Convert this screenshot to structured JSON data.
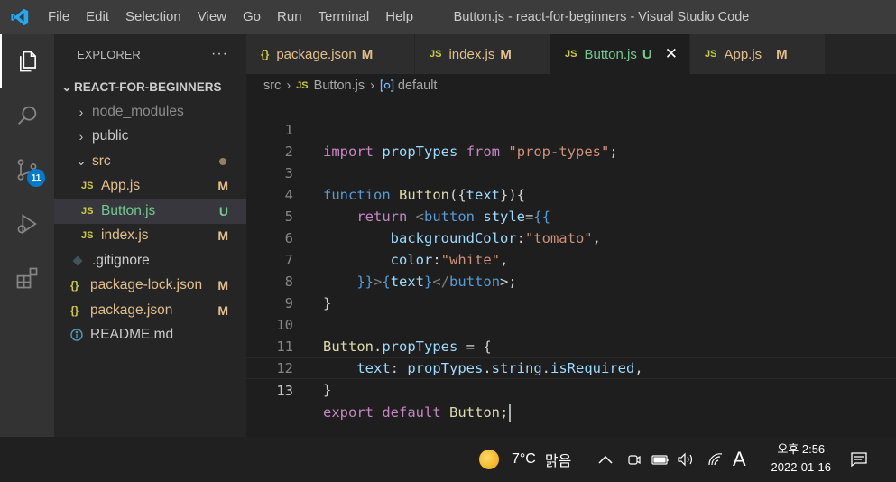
{
  "titlebar": {
    "menu": [
      "File",
      "Edit",
      "Selection",
      "View",
      "Go",
      "Run",
      "Terminal",
      "Help"
    ],
    "window_title": "Button.js - react-for-beginners - Visual Studio Code"
  },
  "activitybar": {
    "items": [
      "explorer-icon",
      "search-icon",
      "source-control-icon",
      "run-debug-icon",
      "extensions-icon"
    ],
    "scm_badge": "11"
  },
  "sidebar": {
    "title": "EXPLORER",
    "more": "···",
    "project": "REACT-FOR-BEGINNERS",
    "rows": [
      {
        "label": "node_modules",
        "status": ""
      },
      {
        "label": "public",
        "status": ""
      },
      {
        "label": "src",
        "status": ""
      },
      {
        "label": "App.js",
        "status": "M"
      },
      {
        "label": "Button.js",
        "status": "U"
      },
      {
        "label": "index.js",
        "status": "M"
      },
      {
        "label": ".gitignore",
        "status": ""
      },
      {
        "label": "package-lock.json",
        "status": "M"
      },
      {
        "label": "package.json",
        "status": "M"
      },
      {
        "label": "README.md",
        "status": ""
      }
    ]
  },
  "tabs": [
    {
      "icon": "{}",
      "label": "package.json",
      "status": "M"
    },
    {
      "icon": "JS",
      "label": "index.js",
      "status": "M"
    },
    {
      "icon": "JS",
      "label": "Button.js",
      "status": "U",
      "close": "✕"
    },
    {
      "icon": "JS",
      "label": "App.js",
      "status": "M"
    }
  ],
  "breadcrumb": {
    "folder": "src",
    "file": "Button.js",
    "symbol": "default",
    "js_icon": "JS"
  },
  "editor": {
    "line_numbers": [
      "1",
      "2",
      "3",
      "4",
      "5",
      "6",
      "7",
      "8",
      "9",
      "10",
      "11",
      "12",
      "13"
    ],
    "tokens": {
      "l1_import": "import",
      "l1_name": "propTypes",
      "l1_from": "from",
      "l1_module": "\"prop-types\"",
      "l1_semi": ";",
      "l3_function": "function",
      "l3_name": "Button",
      "l3_open": "({",
      "l3_param": "text",
      "l3_close": "}){",
      "l4_return": "return",
      "l4_lt": "<",
      "l4_tag": "button",
      "l4_attr": "style",
      "l4_eq": "=",
      "l4_braces": "{{",
      "l5_prop": "backgroundColor",
      "l5_colon": ":",
      "l5_val": "\"tomato\"",
      "l5_comma": ",",
      "l6_prop": "color",
      "l6_colon": ":",
      "l6_val": "\"white\"",
      "l6_comma": ",",
      "l7_braces": "}}",
      "l7_gt": ">",
      "l7_lb": "{",
      "l7_text": "text",
      "l7_rb": "}",
      "l7_close_lt": "</",
      "l7_tag": "button",
      "l7_end": ">;",
      "l8": "}",
      "l10_name": "Button",
      "l10_dot": ".",
      "l10_prop": "propTypes",
      "l10_rest": " = {",
      "l11_key": "text",
      "l11_colon": ": ",
      "l11_obj": "propTypes",
      "l11_dot1": ".",
      "l11_type": "string",
      "l11_dot2": ".",
      "l11_req": "isRequired",
      "l11_comma": ",",
      "l12": "}",
      "l13_export": "export",
      "l13_default": "default",
      "l13_name": "Button",
      "l13_semi": ";"
    }
  },
  "taskbar": {
    "temperature": "7°C",
    "weather": "맑음",
    "ime": "A",
    "time": "오후 2:56",
    "date": "2022-01-16"
  },
  "colors": {
    "accent": "#007acc",
    "modified": "#e2c08d",
    "untracked": "#73c991"
  }
}
